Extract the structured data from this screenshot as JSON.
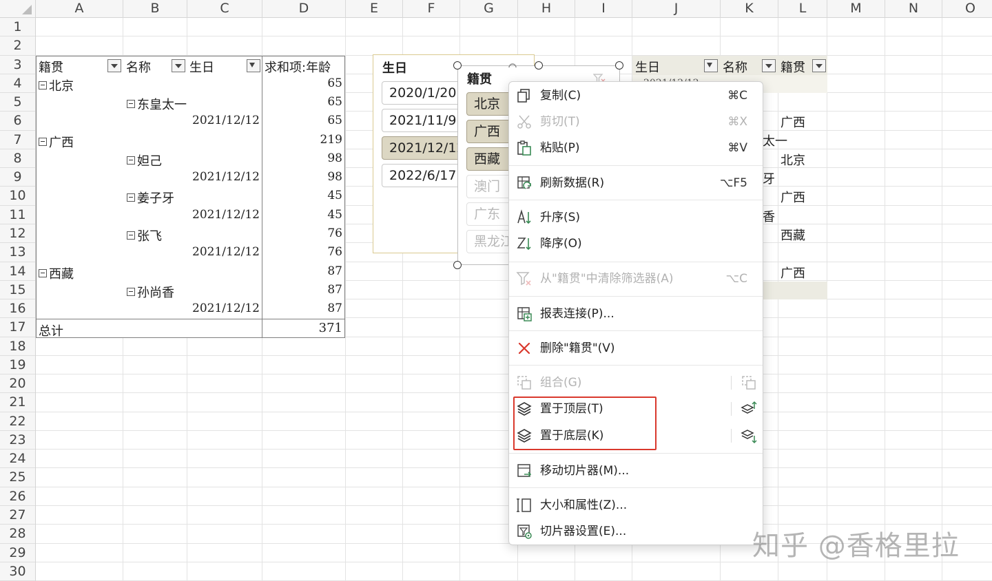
{
  "columns": [
    "A",
    "B",
    "C",
    "D",
    "E",
    "F",
    "G",
    "H",
    "I",
    "J",
    "K",
    "L",
    "M",
    "N",
    "O"
  ],
  "rows": [
    "1",
    "2",
    "3",
    "4",
    "5",
    "6",
    "7",
    "8",
    "9",
    "10",
    "11",
    "12",
    "13",
    "14",
    "15",
    "16",
    "17",
    "18",
    "19",
    "20",
    "21",
    "22",
    "23",
    "24",
    "25",
    "26",
    "27",
    "28",
    "29",
    "30"
  ],
  "pivot": {
    "headers": {
      "region": "籍贯",
      "name": "名称",
      "birthday": "生日",
      "sum": "求和项:年龄"
    },
    "rows": [
      {
        "label": "北京",
        "value": "65"
      },
      {
        "label": "东皇太一",
        "value": "65"
      },
      {
        "label": "2021/12/12",
        "value": "65"
      },
      {
        "label": "广西",
        "value": "219"
      },
      {
        "label": "妲己",
        "value": "98"
      },
      {
        "label": "2021/12/12",
        "value": "98"
      },
      {
        "label": "姜子牙",
        "value": "45"
      },
      {
        "label": "2021/12/12",
        "value": "45"
      },
      {
        "label": "张飞",
        "value": "76"
      },
      {
        "label": "2021/12/12",
        "value": "76"
      },
      {
        "label": "西藏",
        "value": "87"
      },
      {
        "label": "孙尚香",
        "value": "87"
      },
      {
        "label": "2021/12/12",
        "value": "87"
      }
    ],
    "total_label": "总计",
    "total_value": "371"
  },
  "pivot2": {
    "headers": {
      "birthday": "生日",
      "name": "名称",
      "region": "籍贯"
    },
    "partial_top": "2021/12/12",
    "cells": [
      {
        "text": "广西"
      },
      {
        "text": "太一"
      },
      {
        "text": "北京"
      },
      {
        "text": "牙"
      },
      {
        "text": "广西"
      },
      {
        "text": "香"
      },
      {
        "text": "西藏"
      },
      {
        "text": "广西"
      }
    ]
  },
  "slicer_birthday": {
    "title": "生日",
    "items": [
      "2020/1/20",
      "2021/11/9",
      "2021/12/12",
      "2022/6/17"
    ]
  },
  "slicer_region": {
    "title": "籍贯",
    "items": [
      "北京",
      "广西",
      "西藏",
      "澳门",
      "广东",
      "黑龙江"
    ]
  },
  "menu": {
    "items": {
      "copy": {
        "label": "复制(C)",
        "shortcut": "⌘C"
      },
      "cut": {
        "label": "剪切(T)",
        "shortcut": "⌘X"
      },
      "paste": {
        "label": "粘贴(P)",
        "shortcut": "⌘V"
      },
      "refresh": {
        "label": "刷新数据(R)",
        "shortcut": "⌥F5"
      },
      "sort_asc": {
        "label": "升序(S)"
      },
      "sort_desc": {
        "label": "降序(O)"
      },
      "clear_filter": {
        "label": "从\"籍贯\"中清除筛选器(A)",
        "shortcut": "⌥C"
      },
      "report_conn": {
        "label": "报表连接(P)..."
      },
      "delete": {
        "label": "删除\"籍贯\"(V)"
      },
      "group": {
        "label": "组合(G)"
      },
      "bring_front": {
        "label": "置于顶层(T)"
      },
      "send_back": {
        "label": "置于底层(K)"
      },
      "move_slicer": {
        "label": "移动切片器(M)..."
      },
      "size_props": {
        "label": "大小和属性(Z)..."
      },
      "slicer_settings": {
        "label": "切片器设置(E)..."
      }
    }
  },
  "watermark": "知乎 @香格里拉"
}
